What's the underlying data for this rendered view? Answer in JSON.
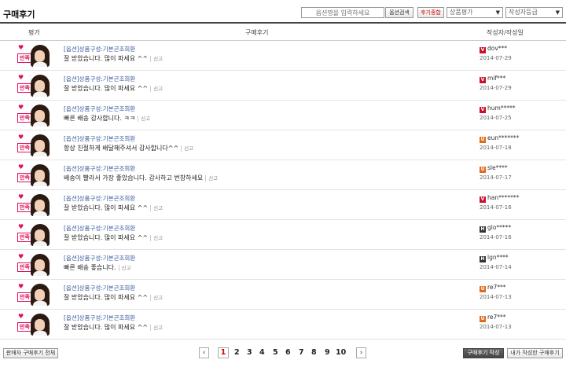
{
  "header": {
    "title": "구매후기",
    "search_placeholder": "옵션명을 입력하세요",
    "search_button": "옵션검색",
    "order_button": "후기종합",
    "rating_select": "상품평가",
    "grade_select": "작성자등급"
  },
  "columns": {
    "rating": "평가",
    "review": "구매후기",
    "author": "작성자/작성일"
  },
  "colors": {
    "heart": "#e0105a",
    "grade_v": "#c8102e",
    "grade_u": "#e06a1a",
    "grade_h": "#333333",
    "option_link": "#3a5a9a"
  },
  "reviews": [
    {
      "rating": "만족",
      "option": "[옵션]상품구성:기본곤조회환",
      "text": "잘 받았습니다. 많이 파세요 ^^",
      "report": "신고",
      "grade": "V",
      "grade_color": "#c8102e",
      "user": "dov***",
      "date": "2014-07-29"
    },
    {
      "rating": "만족",
      "option": "[옵션]상품구성:기본곤조회환",
      "text": "잘 받았습니다. 많이 파세요 ^^",
      "report": "신고",
      "grade": "V",
      "grade_color": "#c8102e",
      "user": "mif***",
      "date": "2014-07-29"
    },
    {
      "rating": "만족",
      "option": "[옵션]상품구성:기본곤조회환",
      "text": "빠른 배송 감사합니다. ㅋㅋ",
      "report": "신고",
      "grade": "V",
      "grade_color": "#c8102e",
      "user": "hum*****",
      "date": "2014-07-25"
    },
    {
      "rating": "만족",
      "option": "[옵션]상품구성:기본곤조회환",
      "text": "항상 친절하게 배달해주셔서 감사합니다^^",
      "report": "신고",
      "grade": "U",
      "grade_color": "#e06a1a",
      "user": "eun*******",
      "date": "2014-07-18"
    },
    {
      "rating": "만족",
      "option": "[옵션]상품구성:기본곤조회환",
      "text": "배송이 빨라서 가장 좋았습니다. 감사하고 번창하세요",
      "report": "신고",
      "grade": "U",
      "grade_color": "#e06a1a",
      "user": "sle****",
      "date": "2014-07-17"
    },
    {
      "rating": "만족",
      "option": "[옵션]상품구성:기본곤조회환",
      "text": "잘 받았습니다. 많이 파세요 ^^",
      "report": "신고",
      "grade": "V",
      "grade_color": "#c8102e",
      "user": "han*******",
      "date": "2014-07-16"
    },
    {
      "rating": "만족",
      "option": "[옵션]상품구성:기본곤조회환",
      "text": "잘 받았습니다. 많이 파세요 ^^",
      "report": "신고",
      "grade": "H",
      "grade_color": "#333333",
      "user": "glo*****",
      "date": "2014-07-16"
    },
    {
      "rating": "만족",
      "option": "[옵션]상품구성:기본곤조회환",
      "text": "빠른 배송 좋습니다.",
      "report": "신고",
      "grade": "H",
      "grade_color": "#333333",
      "user": "lgn****",
      "date": "2014-07-14"
    },
    {
      "rating": "만족",
      "option": "[옵션]상품구성:기본곤조회환",
      "text": "잘 받았습니다. 많이 파세요 ^^",
      "report": "신고",
      "grade": "U",
      "grade_color": "#e06a1a",
      "user": "re7***",
      "date": "2014-07-13"
    },
    {
      "rating": "만족",
      "option": "[옵션]상품구성:기본곤조회환",
      "text": "잘 받았습니다. 많이 파세요 ^^",
      "report": "신고",
      "grade": "U",
      "grade_color": "#e06a1a",
      "user": "re7***",
      "date": "2014-07-13"
    }
  ],
  "footer": {
    "all_reviews_button": "판매자 구매후기 전체",
    "prev": "‹",
    "next": "›",
    "pages": [
      "1",
      "2",
      "3",
      "4",
      "5",
      "6",
      "7",
      "8",
      "9",
      "10"
    ],
    "current_page": "1",
    "write_button": "구매후기 작성",
    "my_reviews_button": "내가 작성한 구매후기"
  }
}
